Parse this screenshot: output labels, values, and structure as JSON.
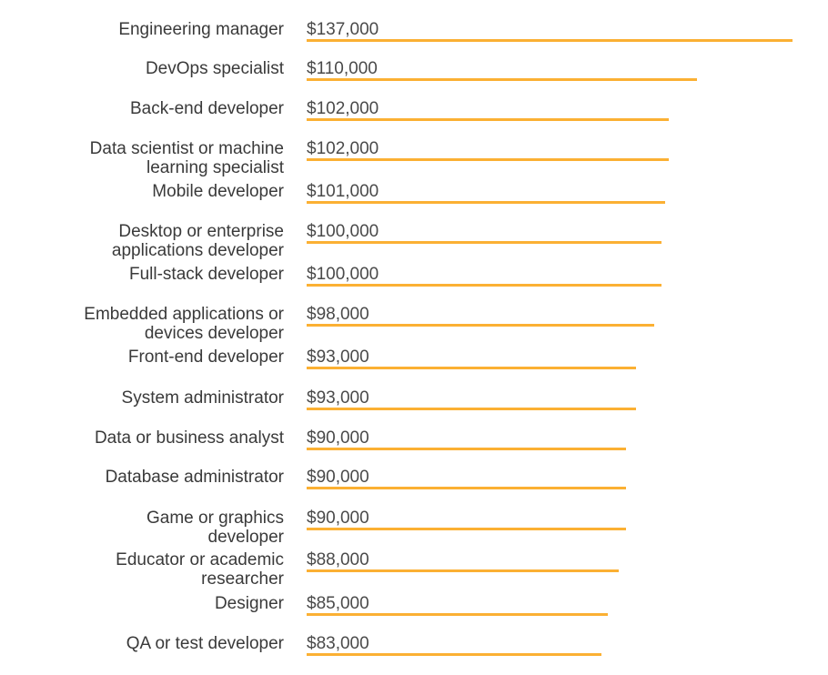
{
  "chart_data": {
    "type": "bar",
    "orientation": "horizontal",
    "title": "",
    "xlabel": "",
    "ylabel": "",
    "xlim": [
      0,
      137000
    ],
    "grid": false,
    "bar_color": "#fbb033",
    "categories": [
      "Engineering manager",
      "DevOps specialist",
      "Back-end developer",
      "Data scientist or machine\nlearning specialist",
      "Mobile developer",
      "Desktop or enterprise\napplications developer",
      "Full-stack developer",
      "Embedded applications or\ndevices developer",
      "Front-end developer",
      "System administrator",
      "Data or business analyst",
      "Database administrator",
      "Game or graphics\ndeveloper",
      "Educator or academic\nresearcher",
      "Designer",
      "QA or test developer"
    ],
    "values": [
      137000,
      110000,
      102000,
      102000,
      101000,
      100000,
      100000,
      98000,
      93000,
      93000,
      90000,
      90000,
      90000,
      88000,
      85000,
      83000
    ],
    "value_labels": [
      "$137,000",
      "$110,000",
      "$102,000",
      "$102,000",
      "$101,000",
      "$100,000",
      "$100,000",
      "$98,000",
      "$93,000",
      "$93,000",
      "$90,000",
      "$90,000",
      "$90,000",
      "$88,000",
      "$85,000",
      "$83,000"
    ]
  }
}
